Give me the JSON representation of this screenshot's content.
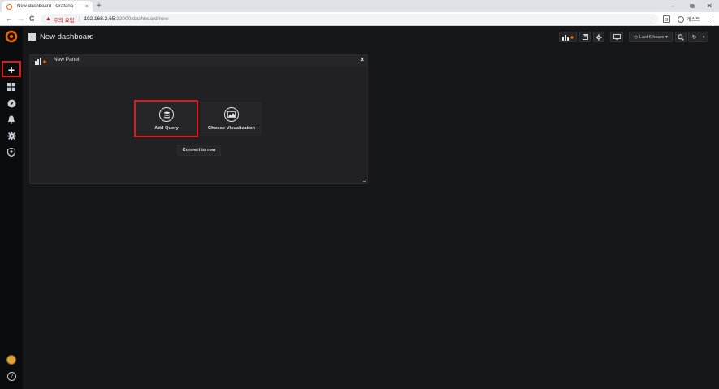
{
  "browser": {
    "tab_title": "New dashboard - Grafana",
    "tab_close": "×",
    "new_tab": "+",
    "window_controls": [
      "–",
      "⧉",
      "✕"
    ],
    "security_warning": "주의 요함",
    "url_host": "192.168.2.65",
    "url_path": ":32000/dashboard/new",
    "profile_name": "게스트",
    "nav": {
      "back": "←",
      "forward": "→",
      "reload": "C"
    },
    "menu_dots": "⋮"
  },
  "navbar": {
    "title": "New dashboard",
    "caret": "▾",
    "time_range": "Last 6 hours",
    "time_caret": "▾",
    "refresh_caret": "▾"
  },
  "sidemenu": {
    "items": [
      "create",
      "dashboards",
      "explore",
      "alerting",
      "configuration",
      "server-admin"
    ],
    "plus": "+",
    "help": "?"
  },
  "panel": {
    "title": "New Panel",
    "close": "×",
    "add_query_label": "Add Query",
    "choose_viz_label": "Choose Visualization",
    "convert_label": "Convert to row"
  },
  "colors": {
    "highlight": "#e0191f",
    "grafana_orange": "#f46800",
    "background": "#161719",
    "panel_bg": "#212124"
  }
}
